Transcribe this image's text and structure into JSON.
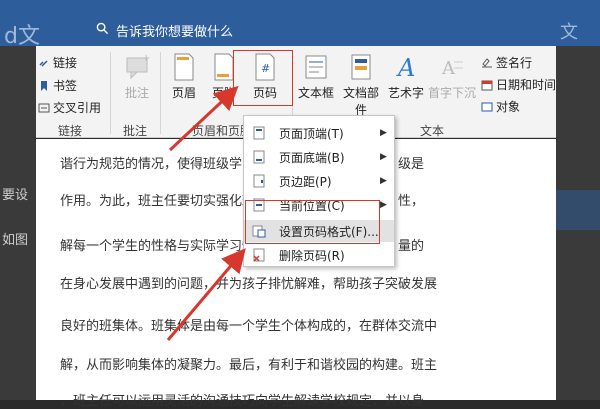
{
  "titlebar": {
    "app_fragment": "d文",
    "tell_me": "告诉我你想要做什么",
    "right_fragment": "文"
  },
  "ribbon": {
    "links_group": {
      "items": [
        "链接",
        "书签",
        "交叉引用"
      ],
      "label": "链接"
    },
    "comment_group": {
      "button": "批注",
      "label": "批注"
    },
    "header_footer_group": {
      "header": "页眉",
      "footer": "页脚",
      "page_number": "页码",
      "label": "页眉和页脚"
    },
    "text_group": {
      "textbox": "文本框",
      "quick_parts": "文档部件",
      "wordart": "艺术字",
      "dropcap": "首字下沉",
      "signature": "签名行",
      "datetime": "日期和时间",
      "object": "对象",
      "label": "文本"
    }
  },
  "dropdown": {
    "items": [
      {
        "label": "页面顶端(T)",
        "submenu": true
      },
      {
        "label": "页面底端(B)",
        "submenu": true
      },
      {
        "label": "页边距(P)",
        "submenu": true
      },
      {
        "label": "当前位置(C)",
        "submenu": true
      },
      {
        "label": "设置页码格式(F)...",
        "submenu": false
      },
      {
        "label": "删除页码(R)",
        "submenu": false
      }
    ]
  },
  "document": {
    "lines": [
      "谐行为规范的情况，使得班级学习氛",
      "作用。为此，班主任要切实强化班级",
      "解每一个学生的性格与实际学习情",
      "在身心发展中遇到的问题，并为孩子排忧解难，帮助孩子突破发展",
      "良好的班集体。班集体是由每一个学生个体构成的，在群体交流中",
      "解，从而影响集体的凝聚力。最后，有利于和谐校园的构建。班主",
      "，班主任可以运用灵活的沟通技巧向学生解读学校规定，并以身"
    ],
    "right_fragments": [
      "级是",
      "性，",
      "量的"
    ],
    "left_fragments": [
      "要设",
      "如图"
    ]
  }
}
